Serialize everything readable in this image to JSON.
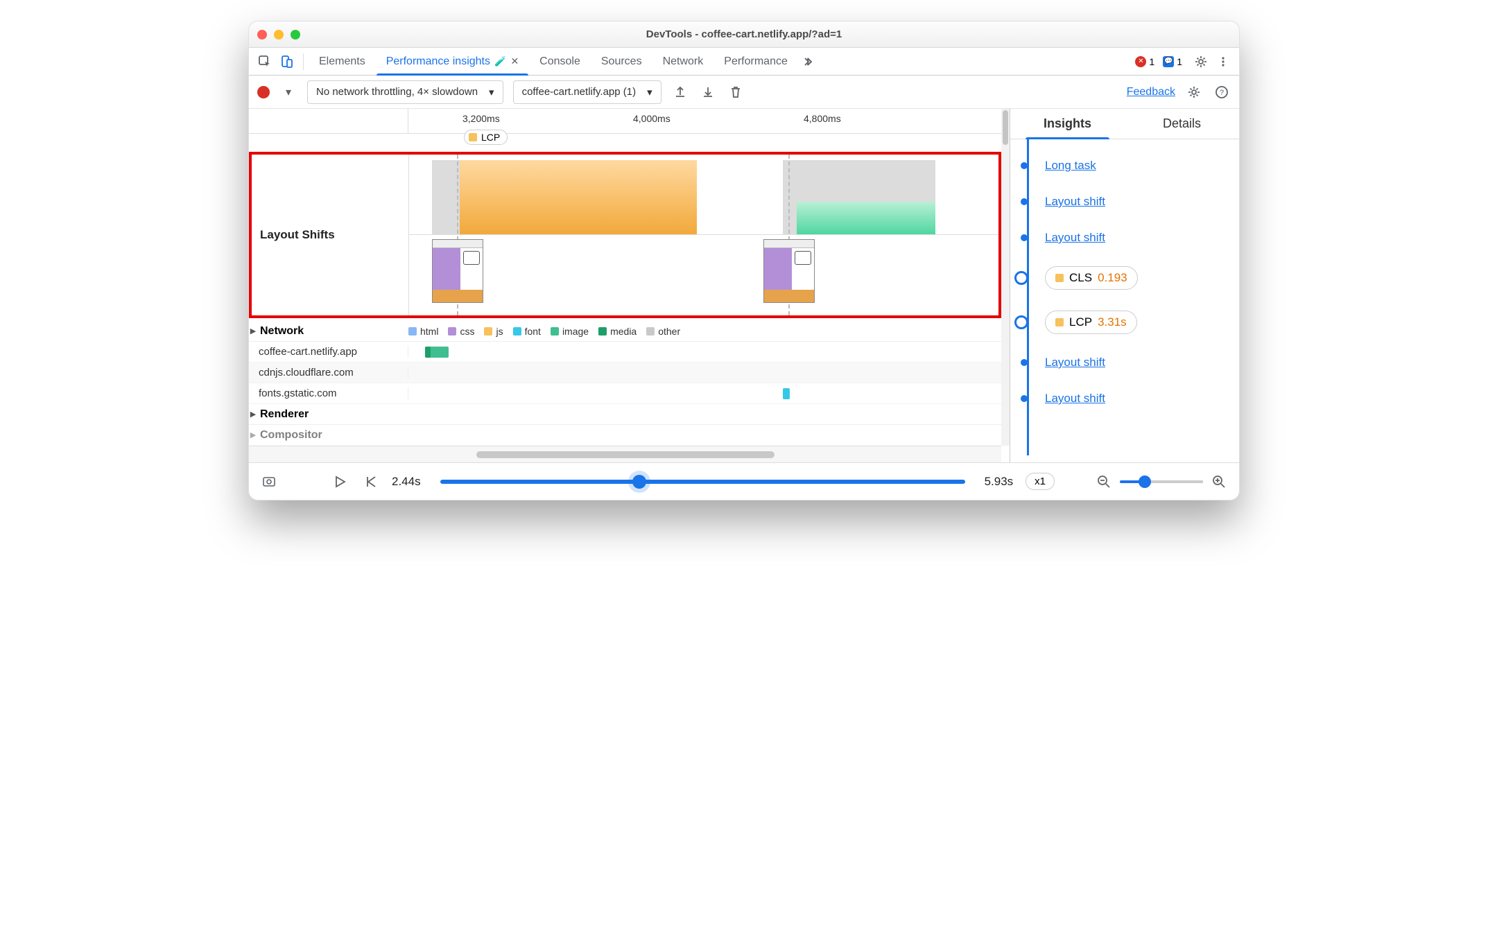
{
  "window": {
    "title": "DevTools - coffee-cart.netlify.app/?ad=1"
  },
  "tabs": {
    "items": [
      "Elements",
      "Performance insights",
      "Console",
      "Sources",
      "Network",
      "Performance"
    ],
    "active_index": 1,
    "errors_count": "1",
    "messages_count": "1"
  },
  "toolbar": {
    "throttle_label": "No network throttling, 4× slowdown",
    "recording_label": "coffee-cart.netlify.app (1)",
    "feedback": "Feedback"
  },
  "timeline": {
    "ticks": [
      "3,200ms",
      "4,000ms",
      "4,800ms"
    ],
    "lcp_chip": "LCP",
    "layout_shifts_label": "Layout Shifts",
    "network_label": "Network",
    "renderer_label": "Renderer",
    "compositor_label": "Compositor",
    "legend": {
      "html": "html",
      "css": "css",
      "js": "js",
      "font": "font",
      "image": "image",
      "media": "media",
      "other": "other"
    },
    "hosts": [
      "coffee-cart.netlify.app",
      "cdnjs.cloudflare.com",
      "fonts.gstatic.com"
    ],
    "colors": {
      "html": "#88b7f5",
      "css": "#b38fd8",
      "js": "#f7c15c",
      "font": "#35c8e8",
      "image": "#3fbf8f",
      "media": "#1e9e6a",
      "other": "#c9c9c9"
    }
  },
  "side": {
    "tabs": [
      "Insights",
      "Details"
    ],
    "items": [
      {
        "type": "link",
        "label": "Long task"
      },
      {
        "type": "link",
        "label": "Layout shift"
      },
      {
        "type": "link",
        "label": "Layout shift"
      },
      {
        "type": "chip",
        "marker": "ring",
        "name": "CLS",
        "value": "0.193",
        "color": "#f7c15c"
      },
      {
        "type": "chip",
        "marker": "ring",
        "name": "LCP",
        "value": "3.31s",
        "color": "#f7c15c"
      },
      {
        "type": "link",
        "label": "Layout shift"
      },
      {
        "type": "link",
        "label": "Layout shift"
      }
    ]
  },
  "footer": {
    "start": "2.44s",
    "end": "5.93s",
    "speed": "x1"
  }
}
